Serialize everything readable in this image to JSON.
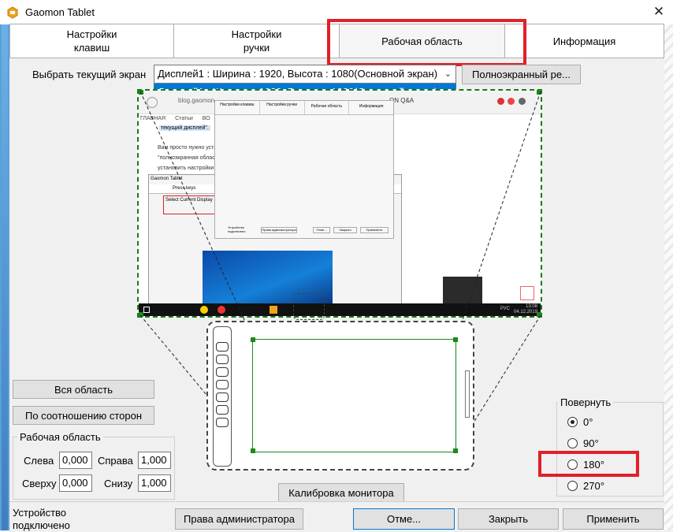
{
  "window": {
    "title": "Gaomon Tablet",
    "close_glyph": "✕"
  },
  "tabs": [
    {
      "line1": "Настройки",
      "line2": "клавиш"
    },
    {
      "line1": "Настройки",
      "line2": "ручки"
    },
    {
      "line1": "Рабочая область",
      "line2": ""
    },
    {
      "line1": "Информация",
      "line2": ""
    }
  ],
  "active_tab": "Рабочая область",
  "display": {
    "label": "Выбрать текущий экран",
    "selected": "Дисплей1 : Ширина : 1920, Высота : 1080(Основной экран)",
    "option": "Дисплей1 : Ширина : 1920, Высота : 1080(Основной экран)",
    "fullscreen_button": "Полноэкранный ре..."
  },
  "preview": {
    "browser_url": "blog.gaomon...",
    "page_texts": [
      "ГЛАВНАЯ",
      "Статьи",
      "ВО",
      "текущий дисплей\".",
      "Вам просто нужно устан",
      "\"полноэкранная област",
      "установить настройки п",
      "ON Q&A"
    ],
    "inner_tabs": [
      "Настройки клавиш",
      "Настройки ручки",
      "Рабочая область",
      "Информация"
    ],
    "inner_window_title": "Gaomon Tablet",
    "inner_press_keys": "Press keys",
    "inner_select_display": "Select Current Display",
    "inner_buttons": [
      "Права администратора",
      "Отме...",
      "Закрыть",
      "Применить"
    ],
    "inner_status": "Устройство подключено",
    "clock": "13:08",
    "date": "04.12.2019",
    "lang": "РУС"
  },
  "buttons": {
    "whole_area": "Вся область",
    "aspect_ratio": "По соотношению сторон",
    "calibrate": "Калибровка монитора",
    "admin": "Права администратора",
    "cancel": "Отме...",
    "close": "Закрыть",
    "apply": "Применить"
  },
  "work_area": {
    "title": "Рабочая область",
    "left_label": "Слева",
    "left_value": "0,000",
    "right_label": "Справа",
    "right_value": "1,000",
    "top_label": "Сверху",
    "top_value": "0,000",
    "bottom_label": "Снизу",
    "bottom_value": "1,000"
  },
  "rotate": {
    "title": "Повернуть",
    "options": [
      "0°",
      "90°",
      "180°",
      "270°"
    ],
    "selected": "0°"
  },
  "status": {
    "line1": "Устройство",
    "line2": "подключено"
  },
  "colors": {
    "highlight_red": "#e0202a",
    "selection_blue": "#0078d7",
    "area_green": "#1a8a1a"
  }
}
